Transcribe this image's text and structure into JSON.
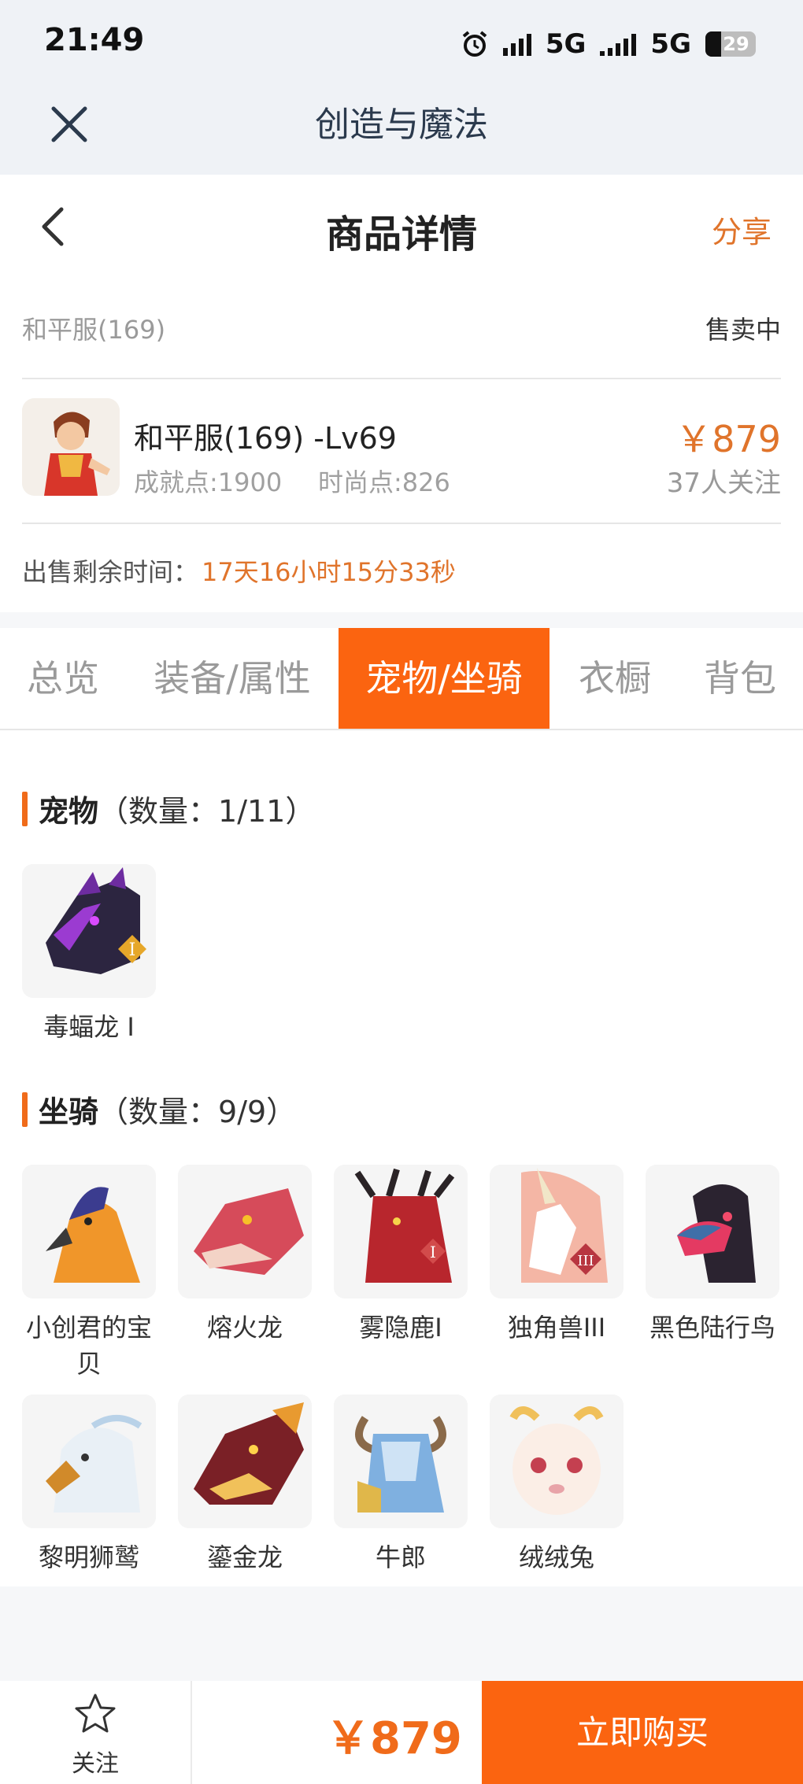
{
  "status_bar": {
    "time": "21:49",
    "network_1": "5G",
    "network_2": "5G",
    "battery": "29"
  },
  "app": {
    "title": "创造与魔法"
  },
  "nav": {
    "title": "商品详情",
    "share": "分享"
  },
  "listing": {
    "server": "和平服(169)",
    "status": "售卖中",
    "product_name": "和平服(169) -Lv69",
    "achievement": "成就点:1900",
    "fashion": "时尚点:826",
    "price": "￥879",
    "followers": "37人关注",
    "time_label": "出售剩余时间：",
    "time_value": "17天16小时15分33秒"
  },
  "tabs": [
    "总览",
    "装备/属性",
    "宠物/坐骑",
    "衣橱",
    "背包"
  ],
  "active_tab": 2,
  "pets": {
    "title": "宠物",
    "count": "（数量：1/11）",
    "items": [
      {
        "name": "毒蝠龙 I"
      }
    ]
  },
  "mounts": {
    "title": "坐骑",
    "count": "（数量：9/9）",
    "row1": [
      {
        "name": "小创君的宝贝"
      },
      {
        "name": "熔火龙"
      },
      {
        "name": "雾隐鹿I"
      },
      {
        "name": "独角兽III"
      },
      {
        "name": "黑色陆行鸟"
      }
    ],
    "row2": [
      {
        "name": "黎明狮鹫"
      },
      {
        "name": "鎏金龙"
      },
      {
        "name": "牛郎"
      },
      {
        "name": "绒绒兔"
      }
    ]
  },
  "bottom": {
    "follow": "关注",
    "price": "￥879",
    "buy": "立即购买"
  },
  "colors": {
    "accent": "#fb6410",
    "price": "#e0742b",
    "header_bg": "#eff2f6"
  }
}
